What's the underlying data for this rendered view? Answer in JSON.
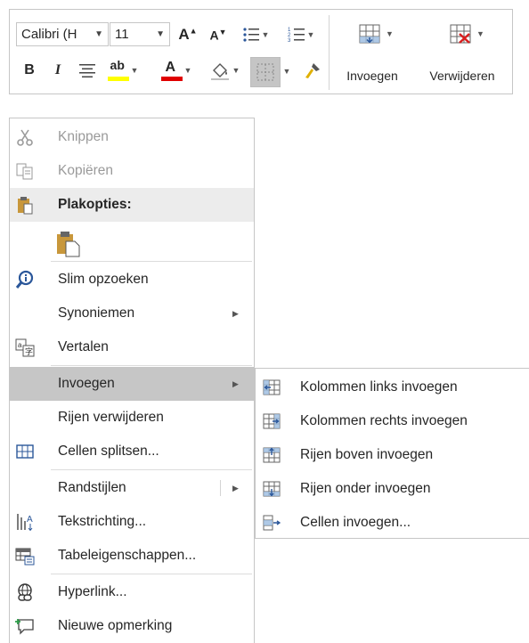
{
  "toolbar": {
    "font_value": "Calibri (H",
    "size_value": "11",
    "insert_label": "Invoegen",
    "delete_label": "Verwijderen",
    "highlight_color": "#ffff00",
    "font_color": "#e00000"
  },
  "menu": {
    "cut": "Knippen",
    "copy": "Kopiëren",
    "paste_options": "Plakopties:",
    "smart_lookup": "Slim opzoeken",
    "synonyms": "Synoniemen",
    "translate": "Vertalen",
    "insert": "Invoegen",
    "delete_rows": "Rijen verwijderen",
    "split_cells": "Cellen splitsen...",
    "border_styles": "Randstijlen",
    "text_direction": "Tekstrichting...",
    "table_properties": "Tabeleigenschappen...",
    "hyperlink": "Hyperlink...",
    "new_comment": "Nieuwe opmerking"
  },
  "submenu": {
    "cols_left": "Kolommen links invoegen",
    "cols_right": "Kolommen rechts invoegen",
    "rows_above": "Rijen boven invoegen",
    "rows_below": "Rijen onder invoegen",
    "insert_cells": "Cellen invoegen..."
  }
}
